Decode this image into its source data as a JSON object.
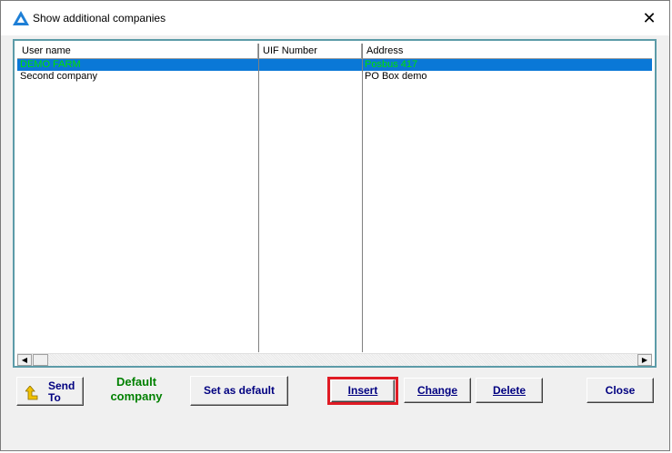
{
  "window": {
    "title": "Show additional companies",
    "close_glyph": "✕"
  },
  "grid": {
    "columns": [
      "User name",
      "UIF Number",
      "Address"
    ],
    "rows": [
      {
        "user_name": "DEMO FARM",
        "uif_number": "",
        "address": "Posbus 417",
        "selected": true
      },
      {
        "user_name": "Second company",
        "uif_number": "",
        "address": "PO Box demo",
        "selected": false
      }
    ]
  },
  "scrollbar": {
    "left_arrow": "◀",
    "right_arrow": "▶"
  },
  "buttons": {
    "send_to_line1": "Send",
    "send_to_line2": "To",
    "default_company_line1": "Default",
    "default_company_line2": "company",
    "set_as_default": "Set as default",
    "insert": "Insert",
    "change": "Change",
    "delete": "Delete",
    "close": "Close"
  },
  "colors": {
    "selection": "#0a78d7",
    "selected_text": "#00e000",
    "default_label": "#008000",
    "highlight": "#e01b24"
  },
  "icons": {
    "app": "app-logo-icon",
    "send": "send-arrow-icon"
  }
}
